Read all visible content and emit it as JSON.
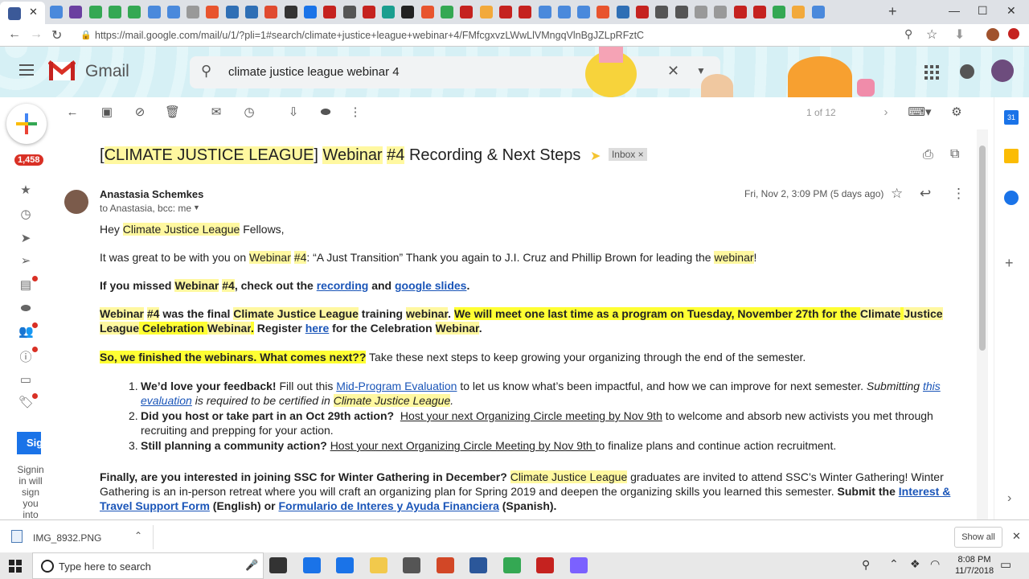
{
  "browser": {
    "url": "https://mail.google.com/mail/u/1/?pli=1#search/climate+justice+league+webinar+4/FMfcgxvzLWwLlVMngqVlnBgJZLpRFztC",
    "new_tab": "+",
    "tab_close": "✕"
  },
  "gmail": {
    "logo_text": "Gmail",
    "search_query": "climate justice league webinar 4",
    "pager": "1 of 12",
    "unread_count": "1,458",
    "sign_button": "Sig",
    "sign_note": "Signin in will sign you into",
    "calendar_badge": "31"
  },
  "email": {
    "subject_parts": [
      "[",
      "CLIMATE JUSTICE LEAGUE",
      "] ",
      "Webinar",
      " ",
      "#4",
      " Recording & Next Steps"
    ],
    "label": "Inbox",
    "label_close": "×",
    "sender": "Anastasia Schemkes",
    "recipients": "to Anastasia, bcc: me",
    "date": "Fri, Nov 2, 3:09 PM (5 days ago)",
    "greeting": [
      "Hey ",
      "Climate Justice League",
      " Fellows,"
    ],
    "p1": [
      "It was great to be with you on ",
      "Webinar",
      " ",
      "#4",
      ": “A Just Transition” Thank you again to J.I. Cruz and Phillip Brown for leading the ",
      "webinar",
      "!"
    ],
    "p2": [
      "If you missed ",
      "Webinar",
      " ",
      "#4",
      ", check out the ",
      "recording",
      " and ",
      "google slides",
      "."
    ],
    "p3": [
      "Webinar",
      " ",
      "#4",
      " was the final ",
      "Climate Justice League",
      " training ",
      "webinar",
      ". ",
      "We will meet one last time as a program on Tuesday, November 27th for the ",
      "Climate",
      " ",
      "Justice",
      " ",
      "League",
      " ",
      "Celebration",
      " ",
      "Webinar",
      ".",
      " Register ",
      "here",
      " for the Celebration ",
      "Webinar",
      "."
    ],
    "p4": [
      "So, we finished the webinars. What comes next??",
      " Take these next steps to keep growing your organizing through the end of the semester."
    ],
    "list": [
      {
        "num": "1.",
        "parts": [
          "We’d love your feedback!",
          " Fill out this ",
          "Mid-Program Evaluation",
          " to let us know what’s been impactful, and how we can improve for next semester. ",
          "Submitting ",
          "this evaluation",
          " is required to be certified in ",
          "Climate Justice League",
          "."
        ]
      },
      {
        "num": "2.",
        "parts": [
          "Did you host or take part in an Oct 29th action?",
          "  ",
          "Host your next Organizing Circle meeting by Nov 9th",
          " to welcome and absorb new activists you met through recruiting and prepping for your action."
        ]
      },
      {
        "num": "3.",
        "parts": [
          "Still planning a community action?",
          " ",
          "Host your next Organizing Circle Meeting by Nov 9th ",
          "to finalize plans and continue action recruitment."
        ]
      }
    ],
    "p5": [
      "Finally, are you interested in joining SSC for Winter Gathering in December?",
      " ",
      "Climate Justice League",
      " graduates are invited to attend SSC’s Winter Gathering! Winter Gathering is an in-person retreat where you will craft an organizing plan for Spring 2019 and deepen the organizing skills you learned this semester. ",
      "Submit the ",
      "Interest & Travel Support Form",
      " (English) or ",
      "Formulario de Interes y Ayuda Financiera",
      " (Spanish)."
    ]
  },
  "download": {
    "file": "IMG_8932.PNG",
    "show_all": "Show all"
  },
  "taskbar": {
    "search_placeholder": "Type here to search",
    "time": "8:08 PM",
    "date": "11/7/2018"
  },
  "colors": {
    "highlight_pale": "#fff8a0",
    "highlight_strong": "#ffff33",
    "link": "#1a55b8",
    "gmail_red": "#d93025"
  }
}
